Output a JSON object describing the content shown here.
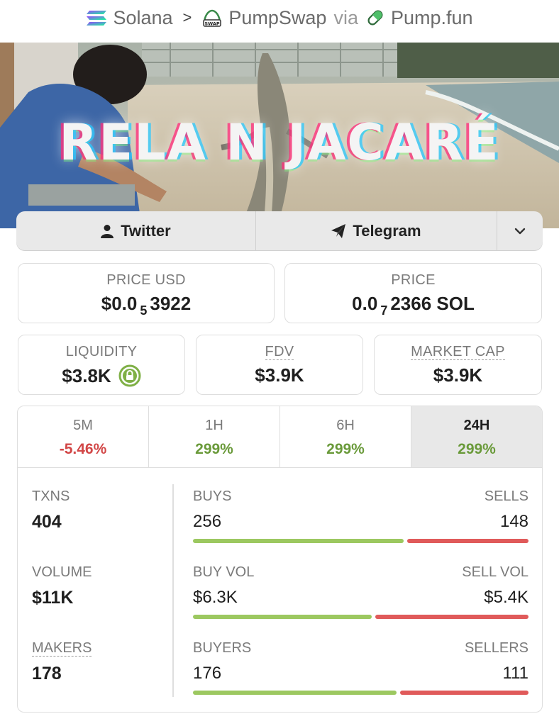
{
  "breadcrumb": {
    "chain": "Solana",
    "separator": ">",
    "dex": "PumpSwap",
    "via": "via",
    "launchpad": "Pump.fun"
  },
  "banner": {
    "title": "RELA N  JACARÉ"
  },
  "links": {
    "twitter": "Twitter",
    "telegram": "Telegram"
  },
  "price_usd": {
    "label": "PRICE USD",
    "prefix": "$0.0",
    "zeros": "5",
    "suffix": "3922"
  },
  "price_native": {
    "label": "PRICE",
    "prefix": "0.0",
    "zeros": "7",
    "suffix": "2366 SOL"
  },
  "liquidity": {
    "label": "LIQUIDITY",
    "value": "$3.8K"
  },
  "fdv": {
    "label": "FDV",
    "value": "$3.9K"
  },
  "market_cap": {
    "label": "MARKET CAP",
    "value": "$3.9K"
  },
  "periods": [
    {
      "label": "5M",
      "change": "-5.46%",
      "direction": "down",
      "active": false
    },
    {
      "label": "1H",
      "change": "299%",
      "direction": "up",
      "active": false
    },
    {
      "label": "6H",
      "change": "299%",
      "direction": "up",
      "active": false
    },
    {
      "label": "24H",
      "change": "299%",
      "direction": "up",
      "active": true
    }
  ],
  "txns": {
    "label": "TXNS",
    "value": "404",
    "buys_label": "BUYS",
    "buys": "256",
    "sells_label": "SELLS",
    "sells": "148",
    "buy_share": 0.634
  },
  "volume": {
    "label": "VOLUME",
    "value": "$11K",
    "buy_label": "BUY VOL",
    "buy": "$6.3K",
    "sell_label": "SELL VOL",
    "sell": "$5.4K",
    "buy_share": 0.538
  },
  "makers": {
    "label": "MAKERS",
    "value": "178",
    "buyers_label": "BUYERS",
    "buyers": "176",
    "sellers_label": "SELLERS",
    "sellers": "111",
    "buy_share": 0.613
  },
  "colors": {
    "positive": "#6a9a3a",
    "negative": "#d24747",
    "buy_bar": "#9cc860",
    "sell_bar": "#e05a5a",
    "lock_green": "#7fb046"
  },
  "icons": [
    "solana-icon",
    "pumpswap-icon",
    "pill-icon",
    "user-icon",
    "paper-plane-icon",
    "chevron-down-icon",
    "lock-icon"
  ]
}
